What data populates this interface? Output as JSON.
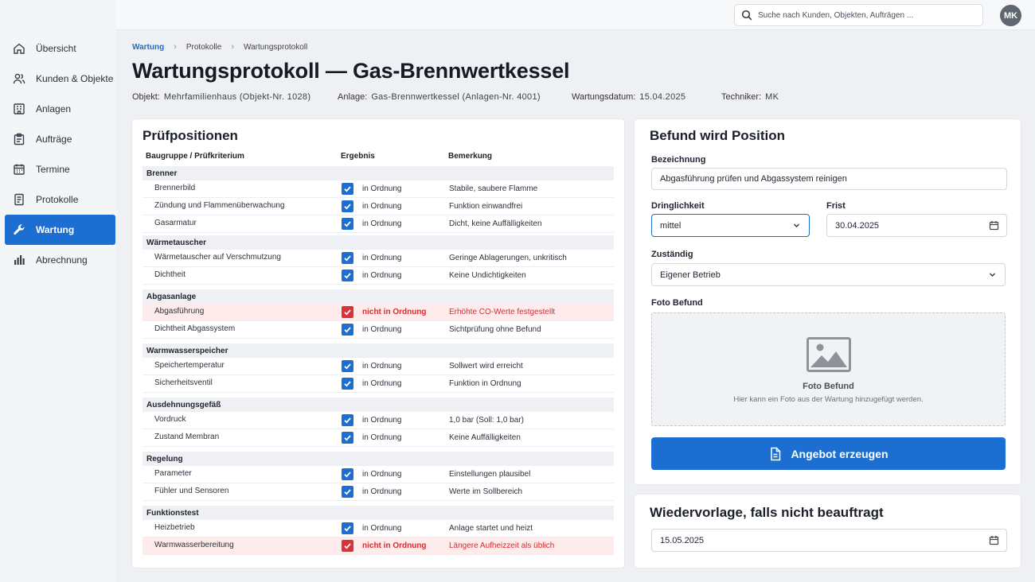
{
  "nav": [
    {
      "label": "Übersicht",
      "icon": "home-icon"
    },
    {
      "label": "Kunden & Objekte",
      "icon": "users-icon"
    },
    {
      "label": "Anlagen",
      "icon": "building-icon"
    },
    {
      "label": "Aufträge",
      "icon": "clipboard-icon"
    },
    {
      "label": "Termine",
      "icon": "calendar-icon"
    },
    {
      "label": "Protokolle",
      "icon": "document-icon"
    },
    {
      "label": "Wartung",
      "icon": "wrench-icon",
      "active": true
    },
    {
      "label": "Abrechnung",
      "icon": "chart-icon"
    }
  ],
  "topbar": {
    "search_placeholder": "Suche nach Kunden, Objekten, Aufträgen ...",
    "avatar_initials": "MK"
  },
  "breadcrumb": [
    "Wartung",
    "Protokolle",
    "Wartungsprotokoll"
  ],
  "page": {
    "title": "Wartungsprotokoll — Gas-Brennwertkessel",
    "meta": [
      {
        "label": "Objekt:",
        "value": "Mehrfamilienhaus (Objekt-Nr. 1028)"
      },
      {
        "label": "Anlage:",
        "value": "Gas-Brennwertkessel (Anlagen-Nr. 4001)"
      },
      {
        "label": "Wartungsdatum:",
        "value": "15.04.2025"
      },
      {
        "label": "Techniker:",
        "value": "MK"
      }
    ]
  },
  "checklist": {
    "title": "Prüfpositionen",
    "headers": [
      "Baugruppe / Prüfkriterium",
      "Ergebnis",
      "Bemerkung"
    ],
    "groups": [
      {
        "name": "Brenner",
        "items": [
          {
            "label": "Brennerbild",
            "result": "in Ordnung",
            "remark": "Stabile, saubere Flamme",
            "ok": true
          },
          {
            "label": "Zündung und Flammenüberwachung",
            "result": "in Ordnung",
            "remark": "Funktion einwandfrei",
            "ok": true
          },
          {
            "label": "Gasarmatur",
            "result": "in Ordnung",
            "remark": "Dicht, keine Auffälligkeiten",
            "ok": true
          }
        ]
      },
      {
        "name": "Wärmetauscher",
        "items": [
          {
            "label": "Wärmetauscher auf Verschmutzung",
            "result": "in Ordnung",
            "remark": "Geringe Ablagerungen, unkritisch",
            "ok": true
          },
          {
            "label": "Dichtheit",
            "result": "in Ordnung",
            "remark": "Keine Undichtigkeiten",
            "ok": true
          }
        ]
      },
      {
        "name": "Abgasanlage",
        "items": [
          {
            "label": "Abgasführung",
            "result": "nicht in Ordnung",
            "remark": "Erhöhte CO-Werte festgestellt",
            "ok": false
          },
          {
            "label": "Dichtheit Abgassystem",
            "result": "in Ordnung",
            "remark": "Sichtprüfung ohne Befund",
            "ok": true
          }
        ]
      },
      {
        "name": "Warmwasserspeicher",
        "items": [
          {
            "label": "Speichertemperatur",
            "result": "in Ordnung",
            "remark": "Sollwert wird erreicht",
            "ok": true
          },
          {
            "label": "Sicherheitsventil",
            "result": "in Ordnung",
            "remark": "Funktion in Ordnung",
            "ok": true
          }
        ]
      },
      {
        "name": "Ausdehnungsgefäß",
        "items": [
          {
            "label": "Vordruck",
            "result": "in Ordnung",
            "remark": "1,0 bar (Soll: 1,0 bar)",
            "ok": true
          },
          {
            "label": "Zustand Membran",
            "result": "in Ordnung",
            "remark": "Keine Auffälligkeiten",
            "ok": true
          }
        ]
      },
      {
        "name": "Regelung",
        "items": [
          {
            "label": "Parameter",
            "result": "in Ordnung",
            "remark": "Einstellungen plausibel",
            "ok": true
          },
          {
            "label": "Fühler und Sensoren",
            "result": "in Ordnung",
            "remark": "Werte im Sollbereich",
            "ok": true
          }
        ]
      },
      {
        "name": "Funktionstest",
        "items": [
          {
            "label": "Heizbetrieb",
            "result": "in Ordnung",
            "remark": "Anlage startet und heizt",
            "ok": true
          },
          {
            "label": "Warmwasserbereitung",
            "result": "nicht in Ordnung",
            "remark": "Längere Aufheizzeit als üblich",
            "ok": false
          }
        ]
      }
    ]
  },
  "finding": {
    "title": "Befund wird Position",
    "designation_label": "Bezeichnung",
    "designation_value": "Abgasführung prüfen und Abgassystem reinigen",
    "urgency_label": "Dringlichkeit",
    "urgency_value": "mittel",
    "deadline_label": "Frist",
    "deadline_value": "30.04.2025",
    "responsible_label": "Zuständig",
    "responsible_value": "Eigener Betrieb",
    "photo_label": "Foto Befund",
    "photo_title": "Foto Befund",
    "photo_hint": "Hier kann ein Foto aus der Wartung hinzugefügt werden.",
    "button_label": "Angebot erzeugen"
  },
  "followup": {
    "title": "Wiedervorlage, falls nicht beauftragt",
    "date_value": "15.05.2025"
  },
  "colors": {
    "accent": "#1c6fd0",
    "danger": "#d9323a",
    "danger_bg": "#fdeceb"
  }
}
